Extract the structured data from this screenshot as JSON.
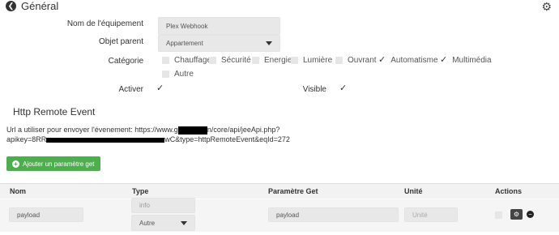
{
  "header": {
    "back_label": "Général",
    "back_icon": "arrow-left-circle-icon",
    "settings_icon": "gears-icon"
  },
  "form": {
    "equipment_name": {
      "label": "Nom de l'équipement",
      "value": "Plex Webhook"
    },
    "parent_object": {
      "label": "Objet parent",
      "value": "Appartement"
    },
    "category": {
      "label": "Catégorie",
      "options": [
        {
          "name": "Chauffage",
          "checked": false
        },
        {
          "name": "Sécurité",
          "checked": false
        },
        {
          "name": "Energie",
          "checked": false
        },
        {
          "name": "Lumière",
          "checked": false
        },
        {
          "name": "Ouvrant",
          "checked": false
        },
        {
          "name": "Automatisme",
          "checked": true
        },
        {
          "name": "Multimédia",
          "checked": true
        },
        {
          "name": "Autre",
          "checked": false
        }
      ]
    },
    "activate": {
      "label": "Activer",
      "checked": true
    },
    "visible": {
      "label": "Visible",
      "checked": true
    }
  },
  "remote_event": {
    "title": "Http Remote Event",
    "url_line1_prefix": "Url a utiliser pour envoyer l'évenement: https://www.g",
    "url_line1_suffix": "n/core/api/jeeApi.php?",
    "url_line2_prefix": "apikey=8RR",
    "url_line2_suffix": "wC&type=httpRemoteEvent&eqId=272",
    "add_button": "Ajouter un paramètre get"
  },
  "table": {
    "columns": [
      "Nom",
      "Type",
      "Paramètre Get",
      "Unité",
      "Actions"
    ],
    "row": {
      "name": "payload",
      "type_info": "info",
      "subtype": "Autre",
      "param": "payload",
      "unit_placeholder": "Unité"
    }
  },
  "colors": {
    "accent_green": "#4cae4c",
    "input_bg": "#e8e8e8"
  }
}
